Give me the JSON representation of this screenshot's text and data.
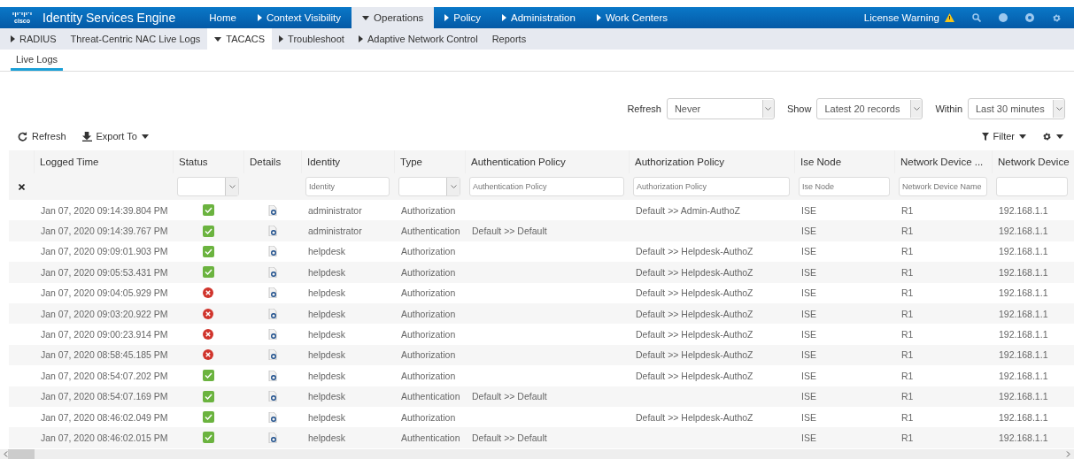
{
  "header": {
    "logo_text": "cisco",
    "product": "Identity Services Engine",
    "nav": [
      {
        "label": "Home",
        "kind": "link",
        "selected": false
      },
      {
        "label": "Context Visibility",
        "kind": "menu",
        "expanded": false,
        "selected": false
      },
      {
        "label": "Operations",
        "kind": "menu",
        "expanded": true,
        "selected": true
      },
      {
        "label": "Policy",
        "kind": "menu",
        "expanded": false,
        "selected": false
      },
      {
        "label": "Administration",
        "kind": "menu",
        "expanded": false,
        "selected": false
      },
      {
        "label": "Work Centers",
        "kind": "menu",
        "expanded": false,
        "selected": false
      }
    ],
    "license_warning": "License Warning"
  },
  "subnav": [
    {
      "label": "RADIUS",
      "kind": "menu",
      "expanded": false,
      "selected": false
    },
    {
      "label": "Threat-Centric NAC Live Logs",
      "kind": "link",
      "selected": false
    },
    {
      "label": "TACACS",
      "kind": "menu",
      "expanded": true,
      "selected": true
    },
    {
      "label": "Troubleshoot",
      "kind": "menu",
      "expanded": false,
      "selected": false
    },
    {
      "label": "Adaptive Network Control",
      "kind": "menu",
      "expanded": false,
      "selected": false
    },
    {
      "label": "Reports",
      "kind": "link",
      "selected": false
    }
  ],
  "tabs": [
    {
      "label": "Live Logs",
      "selected": true
    }
  ],
  "refresh_controls": [
    {
      "label": "Refresh",
      "value": "Never"
    },
    {
      "label": "Show",
      "value": "Latest 20 records"
    },
    {
      "label": "Within",
      "value": "Last 30 minutes"
    }
  ],
  "toolbar": {
    "refresh": "Refresh",
    "export": "Export To",
    "filter": "Filter"
  },
  "table": {
    "columns": [
      "Logged Time",
      "Status",
      "Details",
      "Identity",
      "Type",
      "Authentication Policy",
      "Authorization Policy",
      "Ise Node",
      "Network Device ...",
      "Network Device"
    ],
    "filters": [
      {
        "kind": "none"
      },
      {
        "kind": "select"
      },
      {
        "kind": "none"
      },
      {
        "kind": "text",
        "placeholder": "Identity"
      },
      {
        "kind": "select"
      },
      {
        "kind": "text",
        "placeholder": "Authentication Policy"
      },
      {
        "kind": "text",
        "placeholder": "Authorization Policy"
      },
      {
        "kind": "text",
        "placeholder": "Ise Node"
      },
      {
        "kind": "text",
        "placeholder": "Network Device Name"
      },
      {
        "kind": "text"
      }
    ],
    "rows": [
      {
        "time": "Jan 07, 2020 09:14:39.804 PM",
        "kind": "success",
        "identity": "administrator",
        "type": "Authorization",
        "authn": "",
        "authz": "Default >> Admin-AuthoZ",
        "node": "ISE",
        "device": "R1",
        "ip": "192.168.1.1"
      },
      {
        "time": "Jan 07, 2020 09:14:39.767 PM",
        "kind": "success",
        "identity": "administrator",
        "type": "Authentication",
        "authn": "Default >> Default",
        "authz": "",
        "node": "ISE",
        "device": "R1",
        "ip": "192.168.1.1"
      },
      {
        "time": "Jan 07, 2020 09:09:01.903 PM",
        "kind": "success",
        "identity": "helpdesk",
        "type": "Authorization",
        "authn": "",
        "authz": "Default >> Helpdesk-AuthoZ",
        "node": "ISE",
        "device": "R1",
        "ip": "192.168.1.1"
      },
      {
        "time": "Jan 07, 2020 09:05:53.431 PM",
        "kind": "success",
        "identity": "helpdesk",
        "type": "Authorization",
        "authn": "",
        "authz": "Default >> Helpdesk-AuthoZ",
        "node": "ISE",
        "device": "R1",
        "ip": "192.168.1.1"
      },
      {
        "time": "Jan 07, 2020 09:04:05.929 PM",
        "kind": "failure",
        "identity": "helpdesk",
        "type": "Authorization",
        "authn": "",
        "authz": "Default >> Helpdesk-AuthoZ",
        "node": "ISE",
        "device": "R1",
        "ip": "192.168.1.1"
      },
      {
        "time": "Jan 07, 2020 09:03:20.922 PM",
        "kind": "failure",
        "identity": "helpdesk",
        "type": "Authorization",
        "authn": "",
        "authz": "Default >> Helpdesk-AuthoZ",
        "node": "ISE",
        "device": "R1",
        "ip": "192.168.1.1"
      },
      {
        "time": "Jan 07, 2020 09:00:23.914 PM",
        "kind": "failure",
        "identity": "helpdesk",
        "type": "Authorization",
        "authn": "",
        "authz": "Default >> Helpdesk-AuthoZ",
        "node": "ISE",
        "device": "R1",
        "ip": "192.168.1.1"
      },
      {
        "time": "Jan 07, 2020 08:58:45.185 PM",
        "kind": "failure",
        "identity": "helpdesk",
        "type": "Authorization",
        "authn": "",
        "authz": "Default >> Helpdesk-AuthoZ",
        "node": "ISE",
        "device": "R1",
        "ip": "192.168.1.1"
      },
      {
        "time": "Jan 07, 2020 08:54:07.202 PM",
        "kind": "success",
        "identity": "helpdesk",
        "type": "Authorization",
        "authn": "",
        "authz": "Default >> Helpdesk-AuthoZ",
        "node": "ISE",
        "device": "R1",
        "ip": "192.168.1.1"
      },
      {
        "time": "Jan 07, 2020 08:54:07.169 PM",
        "kind": "success",
        "identity": "helpdesk",
        "type": "Authentication",
        "authn": "Default >> Default",
        "authz": "",
        "node": "ISE",
        "device": "R1",
        "ip": "192.168.1.1"
      },
      {
        "time": "Jan 07, 2020 08:46:02.049 PM",
        "kind": "success",
        "identity": "helpdesk",
        "type": "Authorization",
        "authn": "",
        "authz": "Default >> Helpdesk-AuthoZ",
        "node": "ISE",
        "device": "R1",
        "ip": "192.168.1.1"
      },
      {
        "time": "Jan 07, 2020 08:46:02.015 PM",
        "kind": "success",
        "identity": "helpdesk",
        "type": "Authentication",
        "authn": "Default >> Default",
        "authz": "",
        "node": "ISE",
        "device": "R1",
        "ip": "192.168.1.1"
      }
    ]
  }
}
